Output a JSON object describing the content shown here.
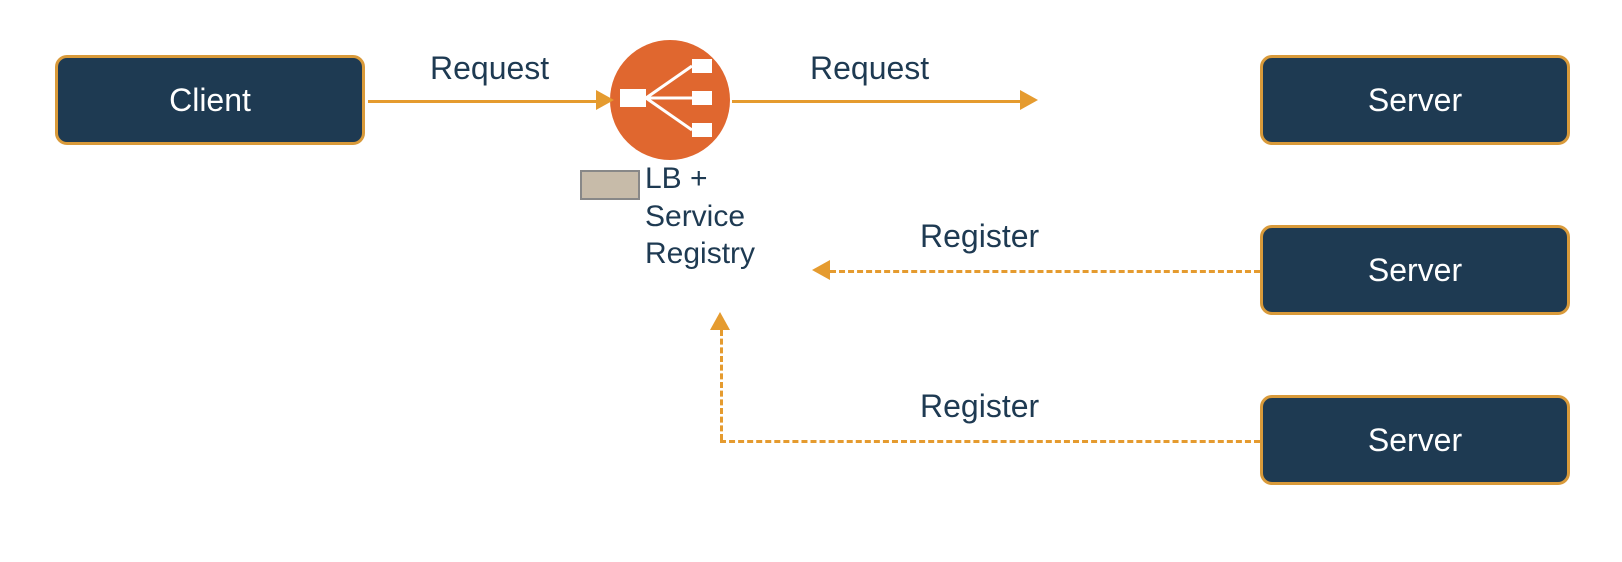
{
  "nodes": {
    "client": "Client",
    "server1": "Server",
    "server2": "Server",
    "server3": "Server",
    "lb_label_line1": "LB +",
    "lb_label_line2": "Service",
    "lb_label_line3": "Registry"
  },
  "arrows": {
    "request1": "Request",
    "request2": "Request",
    "register1": "Register",
    "register2": "Register"
  }
}
